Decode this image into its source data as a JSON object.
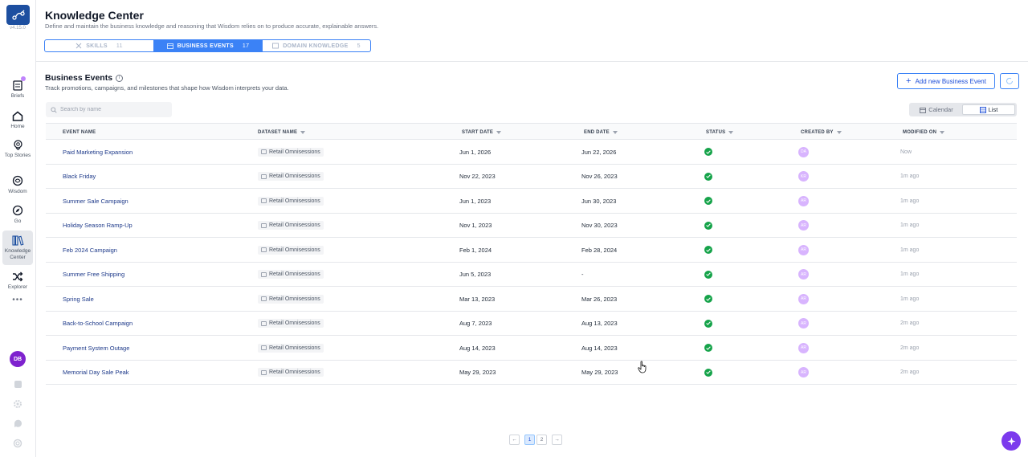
{
  "app": {
    "version": "v4.15.0"
  },
  "sidebar": {
    "items": [
      {
        "label": "Briefs",
        "icon": "briefs-icon"
      },
      {
        "label": "Home",
        "icon": "home-icon"
      },
      {
        "label": "Top Stories",
        "icon": "top-stories-icon"
      },
      {
        "label": "Wisdom",
        "icon": "wisdom-icon"
      },
      {
        "label": "Go",
        "icon": "compass-icon"
      },
      {
        "label": "Knowledge Center",
        "icon": "library-icon",
        "active": true
      },
      {
        "label": "Explorer",
        "icon": "shuffle-icon"
      }
    ],
    "more": "•••",
    "user_initials": "DB"
  },
  "header": {
    "title": "Knowledge Center",
    "description": "Define and maintain the business knowledge and reasoning that Wisdom relies on to produce accurate, explainable answers.",
    "tabs": [
      {
        "label": "SKILLS",
        "count": "11"
      },
      {
        "label": "BUSINESS EVENTS",
        "count": "17",
        "active": true
      },
      {
        "label": "DOMAIN KNOWLEDGE",
        "count": "5"
      }
    ]
  },
  "section": {
    "title": "Business Events",
    "info": "i",
    "description": "Track promotions, campaigns, and milestones that shape how Wisdom interprets your data.",
    "add_button": "Add new Business Event",
    "add_plus": "+"
  },
  "search": {
    "placeholder": "Search by name"
  },
  "view_toggle": {
    "calendar": "Calendar",
    "list": "List",
    "selected": "List"
  },
  "table": {
    "columns": [
      "EVENT NAME",
      "DATASET NAME",
      "START DATE",
      "END DATE",
      "STATUS",
      "CREATED BY",
      "MODIFIED ON"
    ],
    "rows": [
      {
        "name": "Paid Marketing Expansion",
        "dataset": "Retail Omnisessions",
        "start": "Jun 1, 2026",
        "end": "Jun 22, 2026",
        "status": "active",
        "created_by": "DA",
        "modified": "Now"
      },
      {
        "name": "Black Friday",
        "dataset": "Retail Omnisessions",
        "start": "Nov 22, 2023",
        "end": "Nov 26, 2023",
        "status": "active",
        "created_by": "KR",
        "modified": "1m ago"
      },
      {
        "name": "Summer Sale Campaign",
        "dataset": "Retail Omnisessions",
        "start": "Jun 1, 2023",
        "end": "Jun 30, 2023",
        "status": "active",
        "created_by": "AR",
        "modified": "1m ago"
      },
      {
        "name": "Holiday Season Ramp-Up",
        "dataset": "Retail Omnisessions",
        "start": "Nov 1, 2023",
        "end": "Nov 30, 2023",
        "status": "active",
        "created_by": "AR",
        "modified": "1m ago"
      },
      {
        "name": "Feb 2024 Campaign",
        "dataset": "Retail Omnisessions",
        "start": "Feb 1, 2024",
        "end": "Feb 28, 2024",
        "status": "active",
        "created_by": "AR",
        "modified": "1m ago"
      },
      {
        "name": "Summer Free Shipping",
        "dataset": "Retail Omnisessions",
        "start": "Jun 5, 2023",
        "end": "-",
        "status": "active",
        "created_by": "AR",
        "modified": "1m ago"
      },
      {
        "name": "Spring Sale",
        "dataset": "Retail Omnisessions",
        "start": "Mar 13, 2023",
        "end": "Mar 26, 2023",
        "status": "active",
        "created_by": "AR",
        "modified": "1m ago"
      },
      {
        "name": "Back-to-School Campaign",
        "dataset": "Retail Omnisessions",
        "start": "Aug 7, 2023",
        "end": "Aug 13, 2023",
        "status": "active",
        "created_by": "AR",
        "modified": "2m ago"
      },
      {
        "name": "Payment System Outage",
        "dataset": "Retail Omnisessions",
        "start": "Aug 14, 2023",
        "end": "Aug 14, 2023",
        "status": "active",
        "created_by": "AR",
        "modified": "2m ago"
      },
      {
        "name": "Memorial Day Sale Peak",
        "dataset": "Retail Omnisessions",
        "start": "May 29, 2023",
        "end": "May 29, 2023",
        "status": "active",
        "created_by": "AR",
        "modified": "2m ago"
      }
    ]
  },
  "pagination": {
    "prev": "←",
    "pages": [
      "1",
      "2"
    ],
    "current": "1",
    "next": "→"
  },
  "colors": {
    "accent": "#3b82f6",
    "brand": "#1d4fa0",
    "status_ok": "#16a34a",
    "avatar": "#d8b4fe",
    "fab": "#7c3aed"
  }
}
